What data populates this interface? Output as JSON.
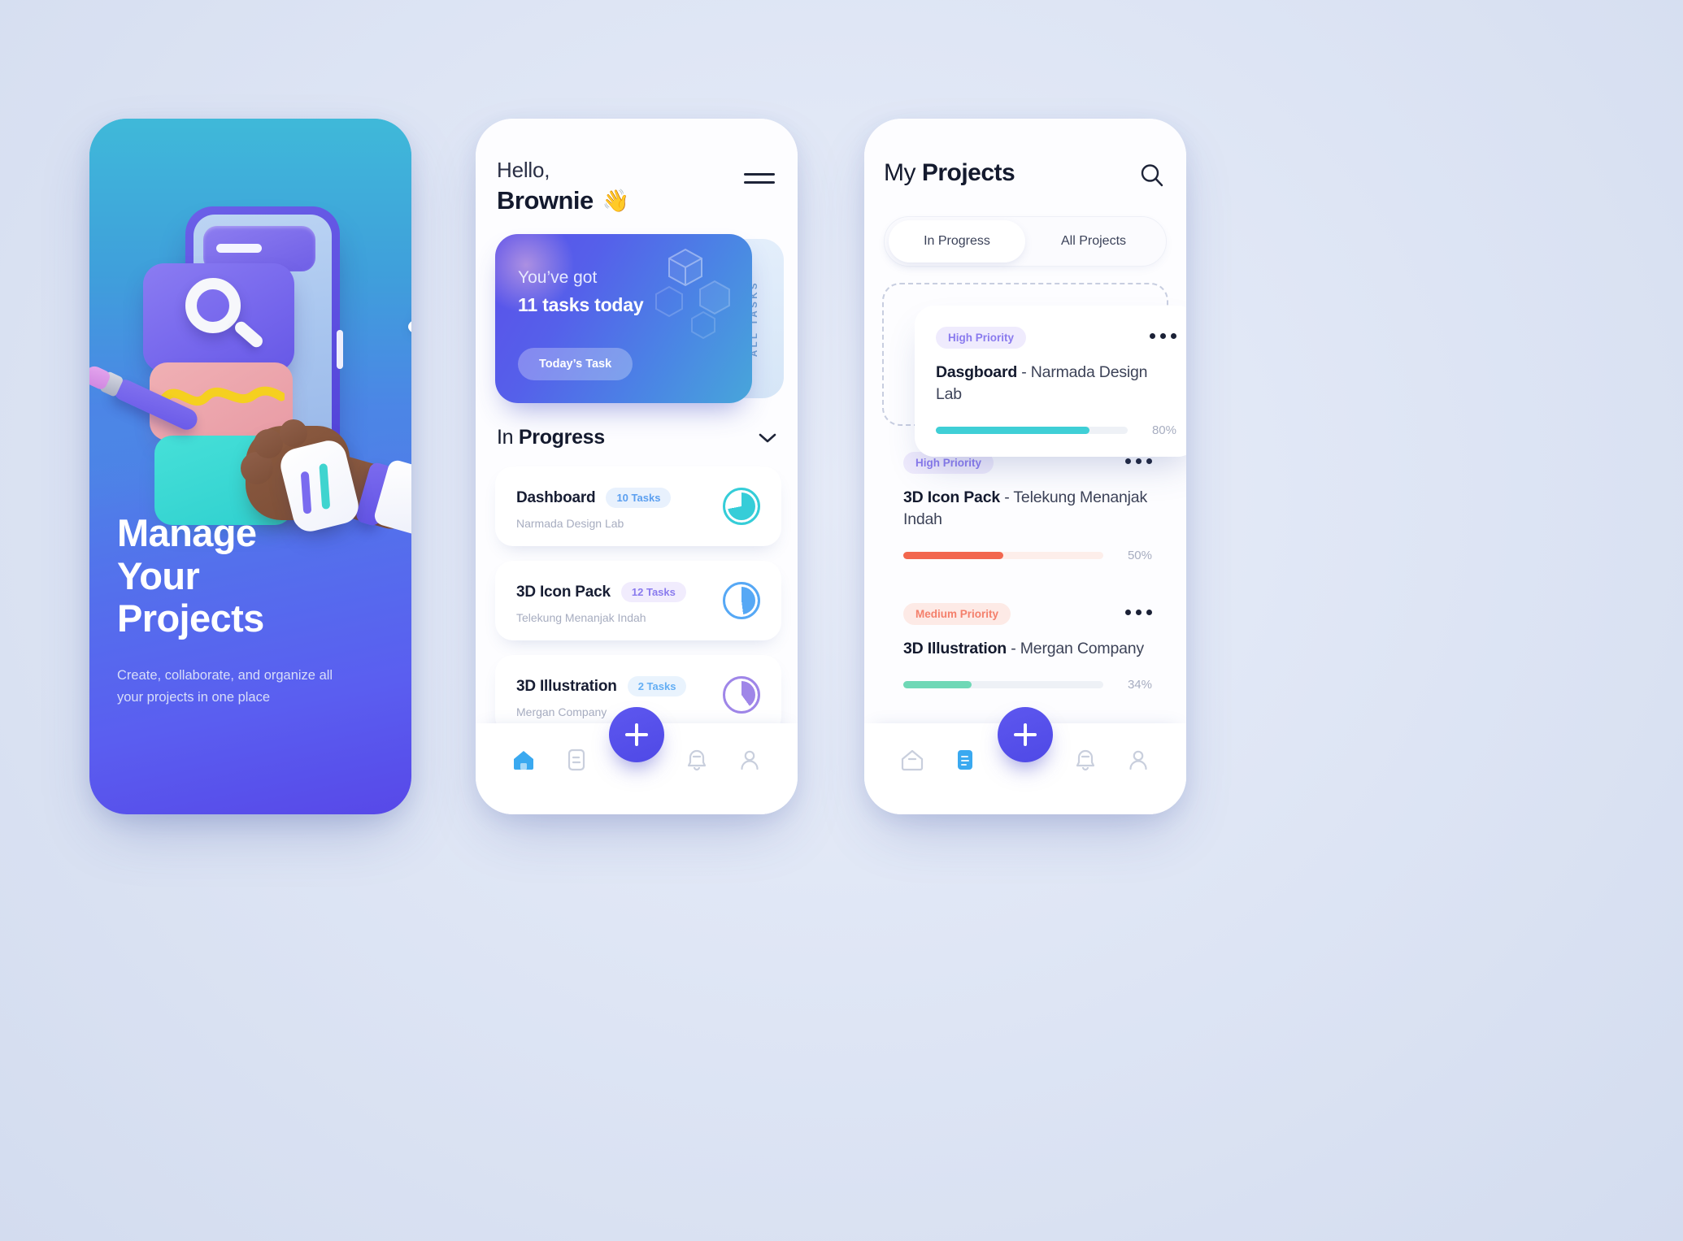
{
  "onboarding": {
    "title_lines": [
      "Manage",
      "Your",
      "Projects"
    ],
    "subtitle": "Create, collaborate, and organize all your projects in one place",
    "next_icon": "chevron-right-icon",
    "illustration": "3d-hand-phone-search-illustration"
  },
  "home": {
    "greeting": "Hello,",
    "username": "Brownie",
    "wave_emoji": "👋",
    "menu_icon": "hamburger-menu-icon",
    "banner": {
      "line1": "You’ve got",
      "line2": "11 tasks today",
      "cta": "Today’s Task",
      "side_label": "ALL TASKS"
    },
    "section": {
      "title_light": "In ",
      "title_bold": "Progress",
      "chevron_icon": "chevron-down-icon"
    },
    "tasks": [
      {
        "name": "Dashboard",
        "badge": "10 Tasks",
        "sub": "Narmada Design Lab",
        "badge_bg": "#e8f1fd",
        "badge_fg": "#5b9ff0",
        "pie_color": "#35cdd8",
        "pie_pct": 72
      },
      {
        "name": "3D Icon Pack",
        "badge": "12 Tasks",
        "sub": "Telekung Menanjak  Indah",
        "badge_bg": "#f1ecfd",
        "badge_fg": "#8a7bee",
        "pie_color": "#56a8f5",
        "pie_pct": 48
      },
      {
        "name": "3D Illustration",
        "badge": "2 Tasks",
        "sub": "Mergan Company",
        "badge_bg": "#e9f3fd",
        "badge_fg": "#63aef4",
        "pie_color": "#9f86e8",
        "pie_pct": 40
      }
    ],
    "fab_icon": "plus-icon",
    "nav": [
      {
        "icon": "home-icon",
        "active": true
      },
      {
        "icon": "document-icon",
        "active": false
      },
      {
        "icon": "bell-icon",
        "active": false
      },
      {
        "icon": "person-icon",
        "active": false
      }
    ]
  },
  "projects": {
    "title_light": "My ",
    "title_bold": "Projects",
    "search_icon": "search-icon",
    "tabs": [
      {
        "label": "In Progress",
        "active": true
      },
      {
        "label": "All Projects",
        "active": false
      }
    ],
    "more_icon": "more-horizontal-icon",
    "items": [
      {
        "priority": "High Priority",
        "title_bold": "Dasgboard",
        "title_rest": " - Narmada Design Lab",
        "percent": "80%",
        "progress": 80,
        "badge_bg": "#efebfd",
        "badge_fg": "#8a7bee",
        "bar": "#3fcfd6",
        "track": "#eef1f6"
      },
      {
        "priority": "High Priority",
        "title_bold": "3D Icon Pack",
        "title_rest": " - Telekung Menanjak  Indah",
        "percent": "50%",
        "progress": 50,
        "badge_bg": "#eeeafc",
        "badge_fg": "#8a7bee",
        "bar": "#f2674e",
        "track": "#fdeeea"
      },
      {
        "priority": "Medium Priority",
        "title_bold": "3D Illustration",
        "title_rest": " - Mergan Company",
        "percent": "34%",
        "progress": 34,
        "badge_bg": "#fdeae6",
        "badge_fg": "#f4806c",
        "bar": "#6fd8b6",
        "track": "#eef1f6"
      }
    ],
    "fab_icon": "plus-icon",
    "nav": [
      {
        "icon": "home-icon",
        "active": false
      },
      {
        "icon": "document-icon",
        "active": true
      },
      {
        "icon": "bell-icon",
        "active": false
      },
      {
        "icon": "person-icon",
        "active": false
      }
    ]
  }
}
